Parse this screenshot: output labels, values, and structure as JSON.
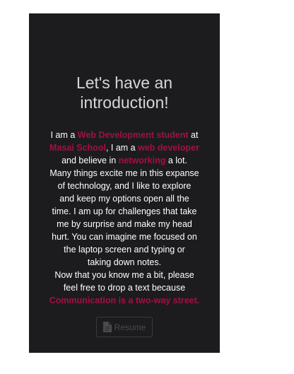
{
  "intro": {
    "title_line1": "Let's have an",
    "title_line2": "introduction!",
    "highlight_color": "#a3103f",
    "bio": {
      "l1_a": "I am a ",
      "l1_hl": "Web Development student",
      "l1_b": " at",
      "l2_hl1": "Masai School",
      "l2_a": ", I am a ",
      "l2_hl2": "web developer",
      "l3_a": "and believe in ",
      "l3_hl": "networking",
      "l3_b": " a lot.",
      "l4": "Many things excite me in this expanse",
      "l5": "of technology, and I like to explore",
      "l6": "and keep my options open all the",
      "l7": "time. I am up for challenges that take",
      "l8": "me by surprise and make my head",
      "l9": "hurt. You can imagine me focused on",
      "l10": "the laptop screen and typing or",
      "l11": "taking down notes.",
      "l12": "Now that you know me a bit, please",
      "l13": "feel free to drop a text because",
      "l14_hl": "Communication is a two-way street."
    }
  },
  "resume": {
    "label": "Resume",
    "icon": "file-icon"
  }
}
